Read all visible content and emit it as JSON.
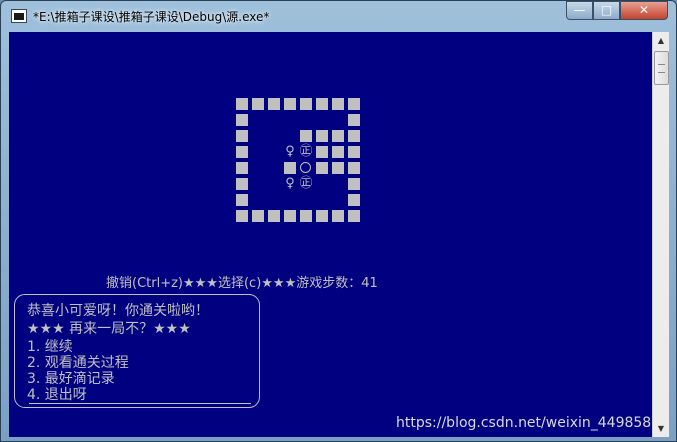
{
  "window": {
    "title": "*E:\\推箱子课设\\推箱子课设\\Debug\\源.exe*",
    "buttons": {
      "minimize": "—",
      "maximize": "□",
      "close": "✕"
    }
  },
  "game": {
    "box_label": "㊣",
    "player_glyph": "♀"
  },
  "status": {
    "undo": "撤销(Ctrl+z)",
    "stars": "★★★",
    "select": "选择(c)",
    "steps_label": "游戏步数：",
    "steps": "41"
  },
  "dialog": {
    "congrats": "恭喜小可爱呀！你通关啦哟！",
    "replay_prompt": "★★★ 再来一局不？★★★",
    "options": [
      "1. 继续",
      "2. 观看通关过程",
      "3. 最好滴记录",
      "4. 退出呀"
    ]
  },
  "watermark": "https://blog.csdn.net/weixin_449858",
  "colors": {
    "console_bg": "#000080",
    "console_fg": "#c0c0c0"
  },
  "icons": {
    "scroll_up": "triangle-up",
    "scroll_down": "triangle-down",
    "app": "console-app"
  }
}
